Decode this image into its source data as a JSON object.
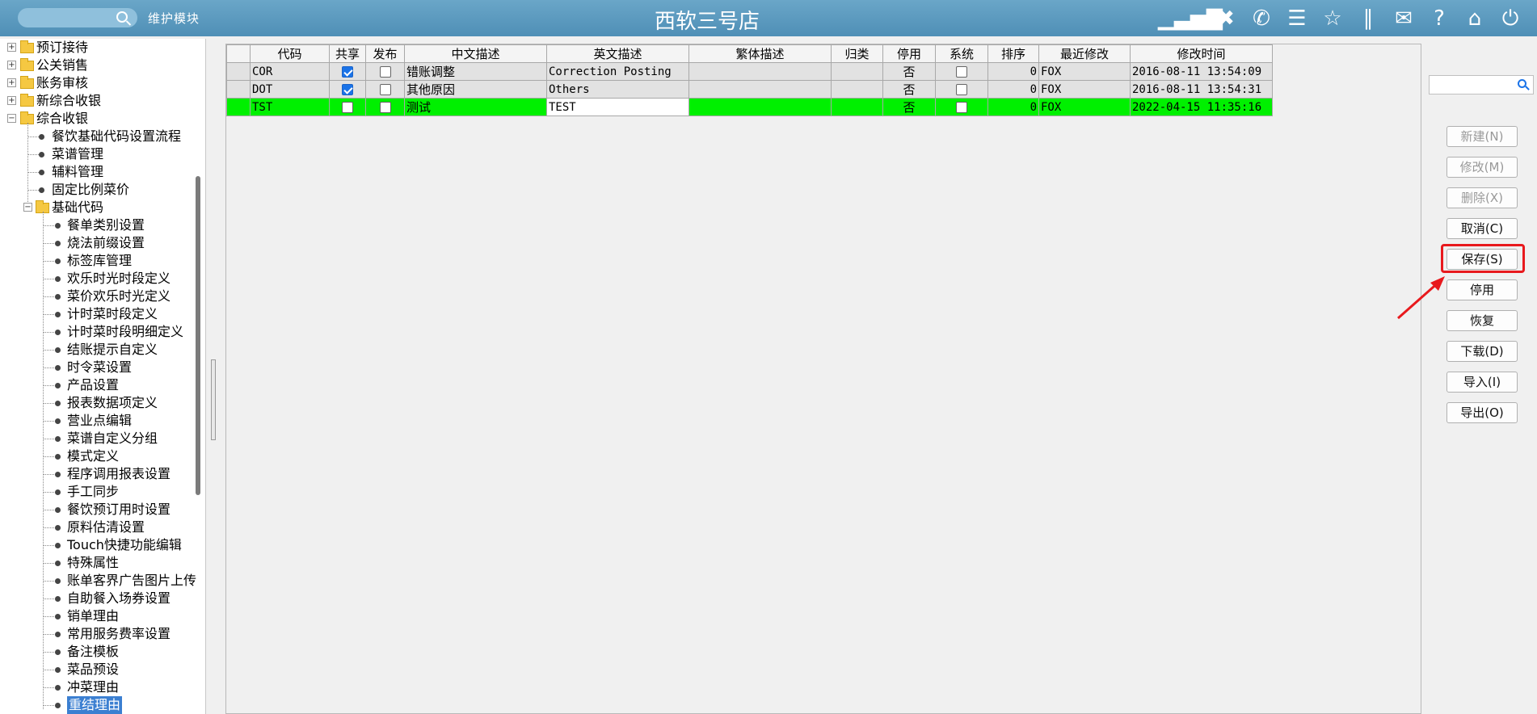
{
  "header": {
    "search_placeholder": "",
    "module_label": "维护模块",
    "title": "西软三号店",
    "icons": [
      "signal-icon",
      "tools-icon",
      "phone-icon",
      "menu-icon",
      "star-icon",
      "columns-icon",
      "mail-icon",
      "help-icon",
      "home-icon",
      "power-icon"
    ]
  },
  "tree": {
    "top_items": [
      "预订接待",
      "公关销售",
      "账务审核",
      "新综合收银",
      "综合收银"
    ],
    "level2_items": [
      "餐饮基础代码设置流程",
      "菜谱管理",
      "辅料管理",
      "固定比例菜价"
    ],
    "basic_code_label": "基础代码",
    "level3_items": [
      "餐单类别设置",
      "烧法前缀设置",
      "标签库管理",
      "欢乐时光时段定义",
      "菜价欢乐时光定义",
      "计时菜时段定义",
      "计时菜时段明细定义",
      "结账提示自定义",
      "时令菜设置",
      "产品设置",
      "报表数据项定义",
      "营业点编辑",
      "菜谱自定义分组",
      "模式定义",
      "程序调用报表设置",
      "手工同步",
      "餐饮预订用时设置",
      "原料估清设置",
      "Touch快捷功能编辑",
      "特殊属性",
      "账单客界广告图片上传",
      "自助餐入场券设置",
      "销单理由",
      "常用服务费率设置",
      "备注模板",
      "菜品预设",
      "冲菜理由",
      "重结理由"
    ]
  },
  "grid": {
    "headers": [
      "代码",
      "共享",
      "发布",
      "中文描述",
      "英文描述",
      "繁体描述",
      "归类",
      "停用",
      "系统",
      "排序",
      "最近修改",
      "修改时间"
    ],
    "rows": [
      {
        "code": "COR",
        "shared": true,
        "publish": false,
        "cn": "错账调整",
        "en": "Correction Posting",
        "tw": "",
        "cat": "",
        "stop": "否",
        "sys": false,
        "order": "0",
        "modifier": "FOX",
        "time": "2016-08-11 13:54:09"
      },
      {
        "code": "DOT",
        "shared": true,
        "publish": false,
        "cn": "其他原因",
        "en": "Others",
        "tw": "",
        "cat": "",
        "stop": "否",
        "sys": false,
        "order": "0",
        "modifier": "FOX",
        "time": "2016-08-11 13:54:31"
      },
      {
        "code": "TST",
        "shared": false,
        "publish": false,
        "cn": "测试",
        "en": "TEST",
        "tw": "",
        "cat": "",
        "stop": "否",
        "sys": false,
        "order": "0",
        "modifier": "FOX",
        "time": "2022-04-15 11:35:16"
      }
    ]
  },
  "actions": {
    "search_placeholder": "",
    "new": "新建(N)",
    "edit": "修改(M)",
    "delete": "删除(X)",
    "cancel": "取消(C)",
    "save": "保存(S)",
    "disable": "停用",
    "restore": "恢复",
    "download": "下载(D)",
    "import": "导入(I)",
    "export": "导出(O)"
  },
  "colors": {
    "header_bg": "#5b9bc2",
    "new_row": "#00f000",
    "selected": "#3b7fd1",
    "highlight": "#e8191d"
  }
}
